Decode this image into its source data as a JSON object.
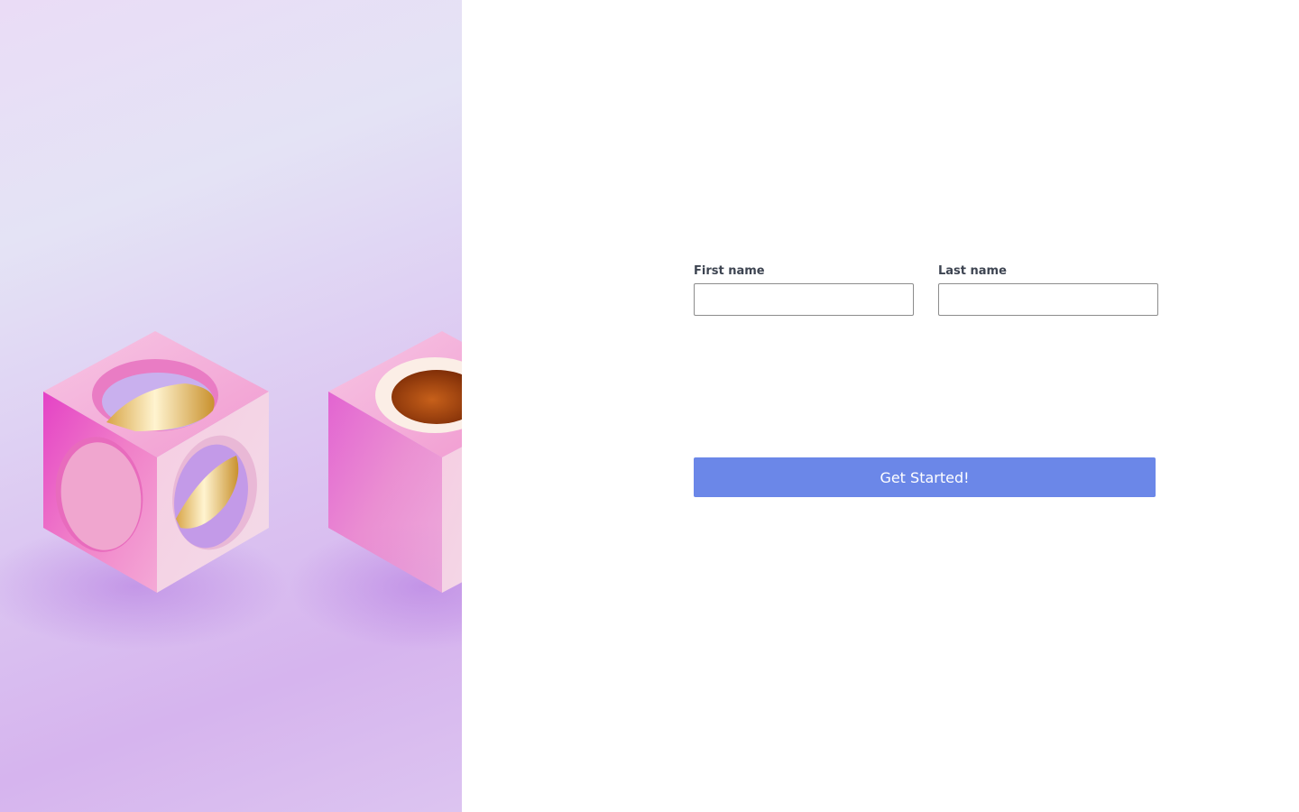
{
  "hero": {
    "image_label": "pink-cubes-illustration"
  },
  "form": {
    "first_name": {
      "label": "First name",
      "value": "",
      "placeholder": ""
    },
    "last_name": {
      "label": "Last name",
      "value": "",
      "placeholder": ""
    },
    "submit_label": "Get Started!"
  },
  "colors": {
    "accent": "#6b87e8",
    "label_text": "#3d4451",
    "cube_pink": "#f2a8d2"
  }
}
